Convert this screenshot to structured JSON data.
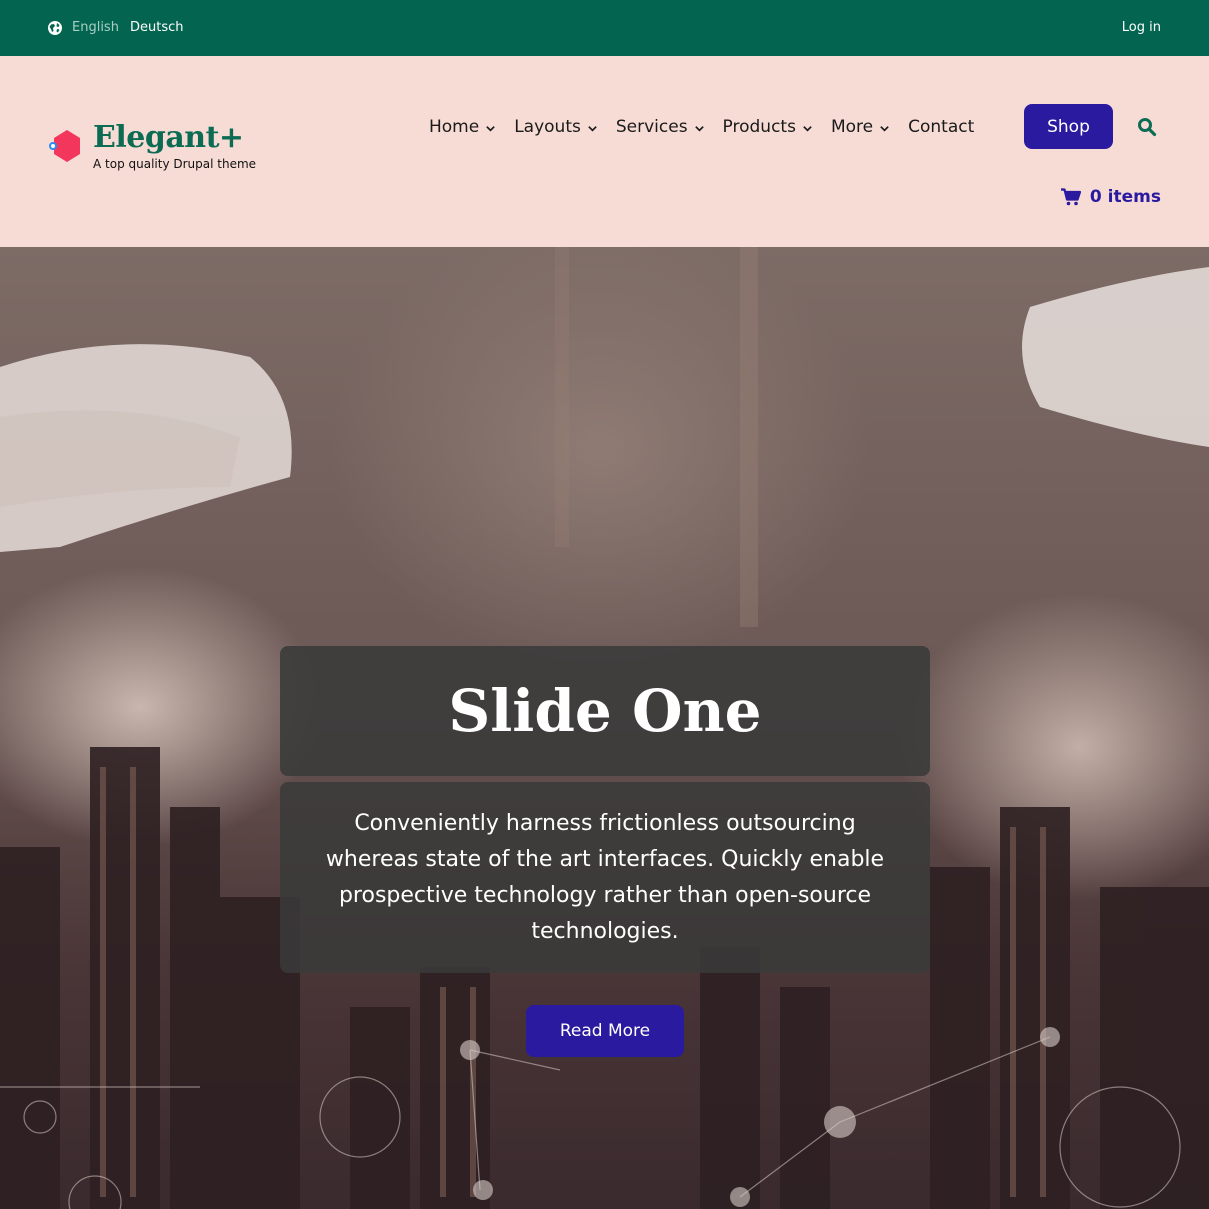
{
  "topbar": {
    "languages": [
      "English",
      "Deutsch"
    ],
    "login": "Log in",
    "background": "#03654f"
  },
  "header": {
    "site_name": "Elegant+",
    "slogan": "A top quality Drupal theme",
    "nav": [
      {
        "label": "Home",
        "dropdown": true
      },
      {
        "label": "Layouts",
        "dropdown": true
      },
      {
        "label": "Services",
        "dropdown": true
      },
      {
        "label": "Products",
        "dropdown": true
      },
      {
        "label": "More",
        "dropdown": true
      },
      {
        "label": "Contact",
        "dropdown": false
      }
    ],
    "shop_label": "Shop",
    "cart_label": "0 items",
    "accent": "#2a1aa0"
  },
  "slider": {
    "title": "Slide One",
    "text": "Conveniently harness frictionless outsourcing whereas state of the art interfaces. Quickly enable prospective technology rather than open-source technologies.",
    "button": "Read More"
  },
  "icons": [
    "globe-icon",
    "chevron-down-icon",
    "search-icon",
    "cart-icon",
    "logo-icon"
  ]
}
